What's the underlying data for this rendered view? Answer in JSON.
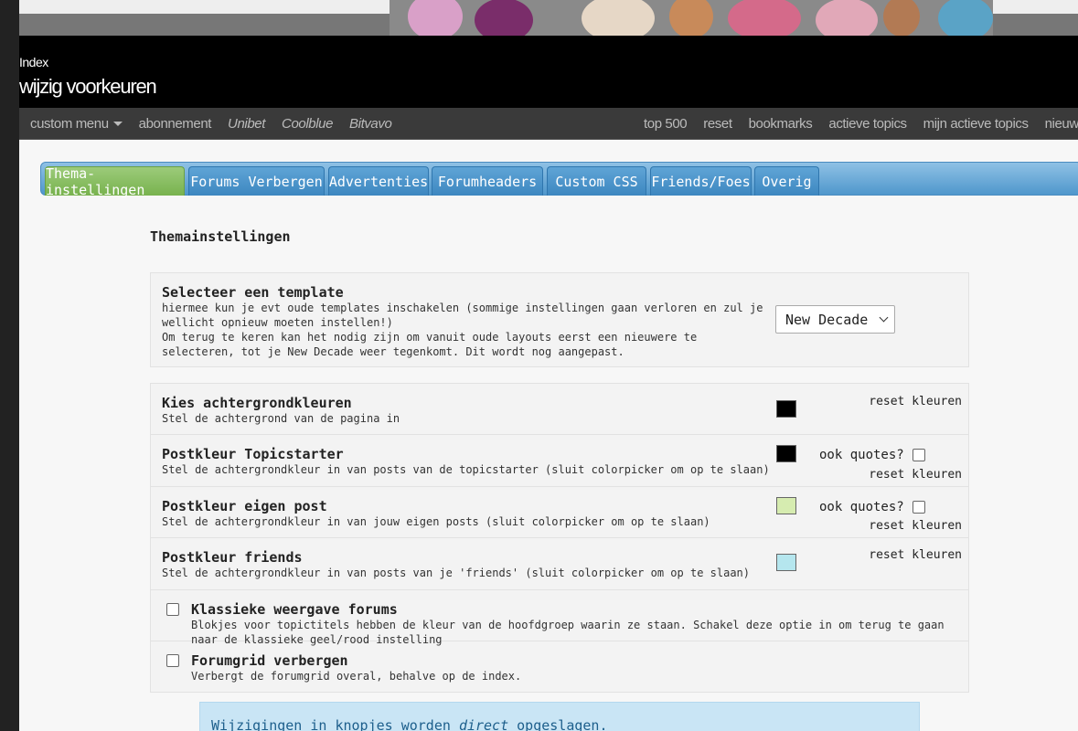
{
  "breadcrumb": "Index",
  "page_title": "wijzig voorkeuren",
  "nav": {
    "left": [
      {
        "label": "custom menu",
        "italic": false,
        "dropdown": true
      },
      {
        "label": "abonnement",
        "italic": false
      },
      {
        "label": "Unibet",
        "italic": true
      },
      {
        "label": "Coolblue",
        "italic": true
      },
      {
        "label": "Bitvavo",
        "italic": true
      }
    ],
    "right": [
      "top 500",
      "reset",
      "bookmarks",
      "actieve topics",
      "mijn actieve topics",
      "nieuwe topics"
    ]
  },
  "tabs": [
    {
      "label": "Thema-instellingen",
      "active": true
    },
    {
      "label": "Forums Verbergen",
      "active": false
    },
    {
      "label": "Advertenties",
      "active": false
    },
    {
      "label": "Forumheaders",
      "active": false
    },
    {
      "label": "Custom CSS",
      "active": false
    },
    {
      "label": "Friends/Foes",
      "active": false
    },
    {
      "label": "Overig",
      "active": false
    }
  ],
  "section_title": "Themainstellingen",
  "template": {
    "title": "Selecteer een template",
    "desc1": "hiermee kun je evt oude templates inschakelen (sommige instellingen gaan verloren en zul je wellicht opnieuw moeten instellen!)",
    "desc2": "Om terug te keren kan het nodig zijn om vanuit oude layouts eerst een nieuwere te selecteren, tot je New Decade weer tegenkomt. Dit wordt nog aangepast.",
    "selected": "New Decade"
  },
  "colors": [
    {
      "title": "Kies achtergrondkleuren",
      "desc": "Stel de achtergrond van de pagina in",
      "color": "#000000",
      "quotes": false,
      "reset": "reset kleuren"
    },
    {
      "title": "Postkleur Topicstarter",
      "desc": "Stel de achtergrondkleur in van posts van de topicstarter (sluit colorpicker om op te slaan)",
      "color": "#000000",
      "quotes": true,
      "quotes_label": "ook quotes?",
      "reset": "reset kleuren"
    },
    {
      "title": "Postkleur eigen post",
      "desc": "Stel de achtergrondkleur in van jouw eigen posts (sluit colorpicker om op te slaan)",
      "color": "#d6ecb0",
      "quotes": true,
      "quotes_label": "ook quotes?",
      "reset": "reset kleuren"
    },
    {
      "title": "Postkleur friends",
      "desc": "Stel de achtergrondkleur in van posts van je 'friends' (sluit colorpicker om op te slaan)",
      "color": "#b5e6ee",
      "quotes": false,
      "reset": "reset kleuren"
    }
  ],
  "options": [
    {
      "title": "Klassieke weergave forums",
      "desc": "Blokjes voor topictitels hebben de kleur van de hoofdgroep waarin ze staan. Schakel deze optie in om terug te gaan naar de klassieke geel/rood instelling",
      "checked": false
    },
    {
      "title": "Forumgrid verbergen",
      "desc": "Verbergt de forumgrid overal, behalve op de index.",
      "checked": false
    }
  ],
  "notice": {
    "before": "Wijzigingen in knopjes worden ",
    "emph": "direct",
    "after": " opgeslagen."
  }
}
